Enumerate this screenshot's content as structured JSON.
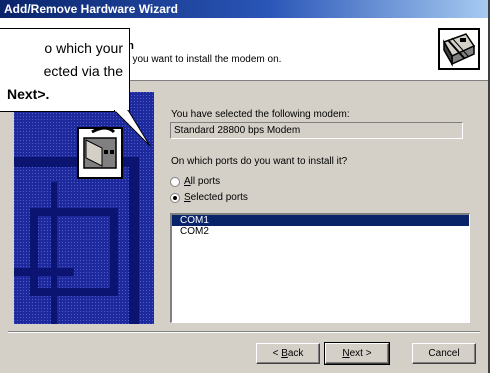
{
  "window": {
    "title": "Add/Remove Hardware Wizard"
  },
  "header": {
    "title_visible": "em",
    "subtitle_visible": "(s) you want to install the modem on.",
    "icon": "modem-port-icon"
  },
  "callout": {
    "lines": [
      "o which your",
      "ected via the",
      "Next>."
    ]
  },
  "content": {
    "selected_label": "You have selected the following modem:",
    "modem_value": "Standard 28800 bps Modem",
    "ports_question": "On which ports do you want to install it?",
    "radio_all_prefix": "",
    "radio_all_u": "A",
    "radio_all_rest": "ll ports",
    "radio_selected_u": "S",
    "radio_selected_rest": "elected ports",
    "selected_option": "Selected ports",
    "ports": [
      "COM1",
      "COM2"
    ],
    "selected_port": "COM1"
  },
  "buttons": {
    "back_prefix": "< ",
    "back_u": "B",
    "back_rest": "ack",
    "next_u": "N",
    "next_rest": "ext >",
    "cancel": "Cancel"
  },
  "colors": {
    "titlebar_start": "#0a246a",
    "selection": "#0a246a",
    "face": "#d4d0c8",
    "panel_blue": "#2c3cb4"
  }
}
